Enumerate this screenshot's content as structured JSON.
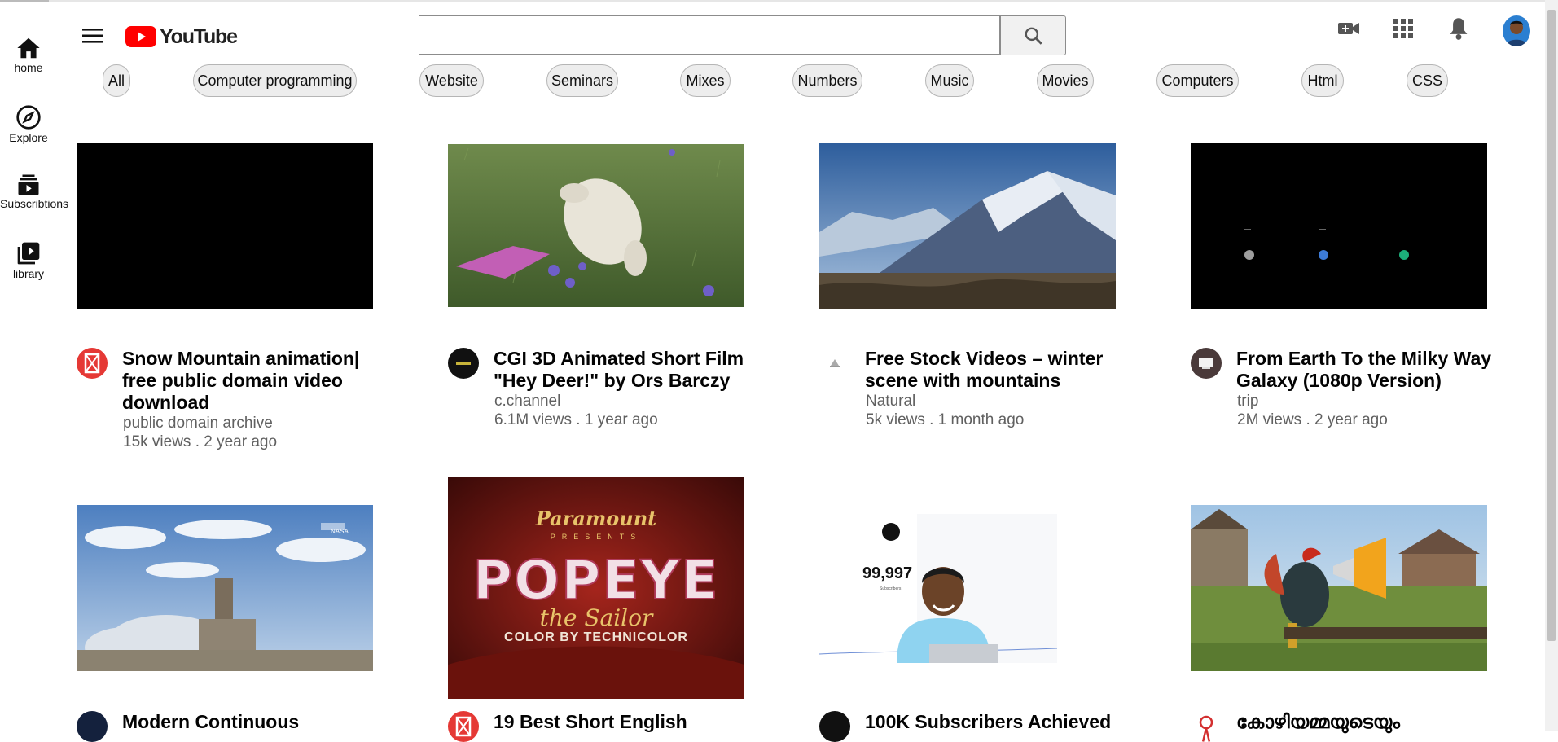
{
  "header": {
    "logo_text": "YouTube",
    "search_placeholder": "",
    "icons": [
      "menu-icon",
      "search-icon",
      "video-camera-icon",
      "apps-grid-icon",
      "bell-icon",
      "avatar"
    ]
  },
  "sidebar": {
    "items": [
      {
        "label": "home",
        "icon": "home-icon"
      },
      {
        "label": "Explore",
        "icon": "compass-icon"
      },
      {
        "label": "Subscribtions",
        "icon": "subscriptions-icon"
      },
      {
        "label": "library",
        "icon": "library-icon"
      }
    ]
  },
  "chips": [
    "All",
    "Computer programming",
    "Website",
    "Seminars",
    "Mixes",
    "Numbers",
    "Music",
    "Movies",
    "Computers",
    "Html",
    "CSS"
  ],
  "videos": [
    {
      "title_line1": "Snow Mountain animation|",
      "title_line2": "free public domain video",
      "title_line3": "download",
      "channel": "public domain archive",
      "meta": "15k views . 2 year ago"
    },
    {
      "title_line1": "CGI 3D Animated Short Film",
      "title_line2": "\"Hey Deer!\" by Ors Barczy",
      "channel": "c.channel",
      "meta": "6.1M views . 1 year ago"
    },
    {
      "title_line1": "Free Stock Videos – winter",
      "title_line2": "scene with mountains",
      "channel": "Natural",
      "meta": "5k views . 1 month ago"
    },
    {
      "title_line1": "From Earth To the Milky Way",
      "title_line2": "Galaxy (1080p Version)",
      "channel": "trip",
      "meta": "2M views . 2 year ago"
    },
    {
      "title_line1": "Modern Continuous"
    },
    {
      "title_line1": "19 Best Short English"
    },
    {
      "title_line1": "100K Subscribers Achieved",
      "thumb_text": "99,997",
      "thumb_small": "Subscribers"
    },
    {
      "title_line1": "കോഴിയമ്മയുടെയും"
    }
  ],
  "thumb_texts": {
    "paramount": "Paramount",
    "presents": "PRESENTS",
    "popeye": "POPEYE",
    "sailor": "the Sailor",
    "technicolor": "COLOR BY TECHNICOLOR",
    "nasa": "NASA"
  },
  "colors": {
    "youtube_red": "#ff0000",
    "chip_bg": "#ededed",
    "meta_gray": "#606060"
  }
}
